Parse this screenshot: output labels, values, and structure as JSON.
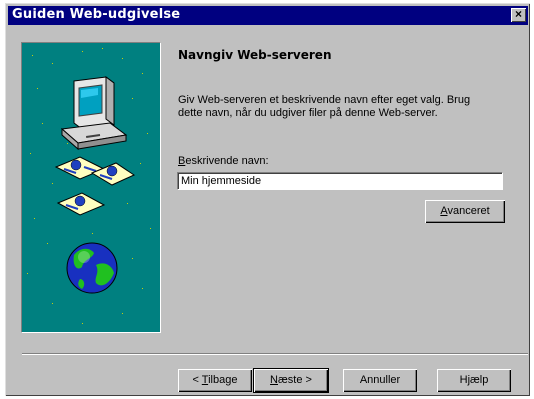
{
  "window": {
    "title": "Guiden Web-udgivelse",
    "close_glyph": "×"
  },
  "page": {
    "heading": "Navngiv Web-serveren",
    "description_line1": "Giv Web-serveren et beskrivende navn efter eget valg. Brug",
    "description_line2": "dette navn, når du udgiver filer på denne Web-server."
  },
  "name_field": {
    "label_access_key": "B",
    "label_rest": "eskrivende navn:",
    "value": "Min hjemmeside"
  },
  "buttons": {
    "advanced": {
      "access_key": "A",
      "rest": "vanceret"
    },
    "back": {
      "prefix": "< ",
      "access_key": "T",
      "rest": "ilbage"
    },
    "next": {
      "access_key": "N",
      "rest": "æste >"
    },
    "cancel": "Annuller",
    "help": "Hjælp"
  },
  "art": {
    "background_color": "#008080",
    "icons": [
      "computer-icon",
      "web-document-icon",
      "web-document-icon",
      "web-document-icon",
      "globe-icon"
    ]
  }
}
